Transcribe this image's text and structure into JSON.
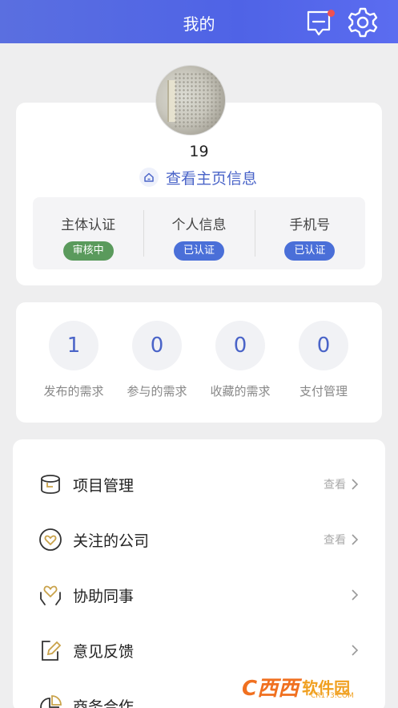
{
  "header": {
    "title": "我的",
    "icons": [
      "message-icon",
      "gear-icon"
    ],
    "accent": "#4f63e6"
  },
  "profile": {
    "username": "19",
    "home_link": "查看主页信息",
    "verify": [
      {
        "label": "主体认证",
        "badge": "审核中",
        "badge_color": "#5a9a5c"
      },
      {
        "label": "个人信息",
        "badge": "已认证",
        "badge_color": "#4a6fd8"
      },
      {
        "label": "手机号",
        "badge": "已认证",
        "badge_color": "#4a6fd8"
      }
    ]
  },
  "stats": [
    {
      "value": "1",
      "label": "发布的需求"
    },
    {
      "value": "0",
      "label": "参与的需求"
    },
    {
      "value": "0",
      "label": "收藏的需求"
    },
    {
      "value": "0",
      "label": "支付管理"
    }
  ],
  "menu": [
    {
      "label": "项目管理",
      "hint": "查看",
      "icon": "project-icon"
    },
    {
      "label": "关注的公司",
      "hint": "查看",
      "icon": "heart-circle-icon"
    },
    {
      "label": "协助同事",
      "hint": "",
      "icon": "hands-heart-icon"
    },
    {
      "label": "意见反馈",
      "hint": "",
      "icon": "feedback-edit-icon"
    },
    {
      "label": "商务合作",
      "hint": "",
      "icon": "pie-icon"
    }
  ],
  "watermark": {
    "logo": "C西西",
    "text": "软件园",
    "sub": "CR173.COM"
  }
}
